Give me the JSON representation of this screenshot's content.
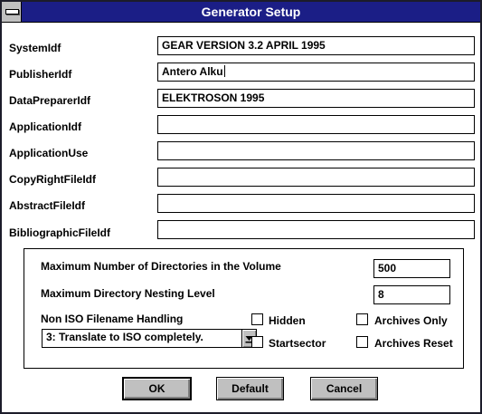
{
  "window": {
    "title": "Generator Setup"
  },
  "fields": [
    {
      "label": "SystemIdf",
      "value": "GEAR VERSION 3.2 APRIL 1995"
    },
    {
      "label": "PublisherIdf",
      "value": "Antero Alku"
    },
    {
      "label": "DataPreparerIdf",
      "value": "ELEKTROSON 1995"
    },
    {
      "label": "ApplicationIdf",
      "value": ""
    },
    {
      "label": "ApplicationUse",
      "value": ""
    },
    {
      "label": "CopyRightFileIdf",
      "value": ""
    },
    {
      "label": "AbstractFileIdf",
      "value": ""
    },
    {
      "label": "BibliographicFileIdf",
      "value": ""
    }
  ],
  "group": {
    "max_dirs_label": "Maximum Number of Directories in the Volume",
    "max_dirs_value": "500",
    "max_nesting_label": "Maximum Directory Nesting Level",
    "max_nesting_value": "8",
    "non_iso_label": "Non ISO Filename Handling",
    "non_iso_selected": "3:  Translate to ISO completely.",
    "checkboxes": {
      "hidden": {
        "label": "Hidden",
        "checked": false
      },
      "archives_only": {
        "label": "Archives Only",
        "checked": false
      },
      "startsector": {
        "label": "Startsector",
        "checked": false
      },
      "archives_reset": {
        "label": "Archives Reset",
        "checked": false
      }
    }
  },
  "buttons": {
    "ok": "OK",
    "default": "Default",
    "cancel": "Cancel"
  },
  "colors": {
    "titlebar": "#1b1e86",
    "title_text": "#ffffff",
    "button_face": "#c0c0c0"
  }
}
